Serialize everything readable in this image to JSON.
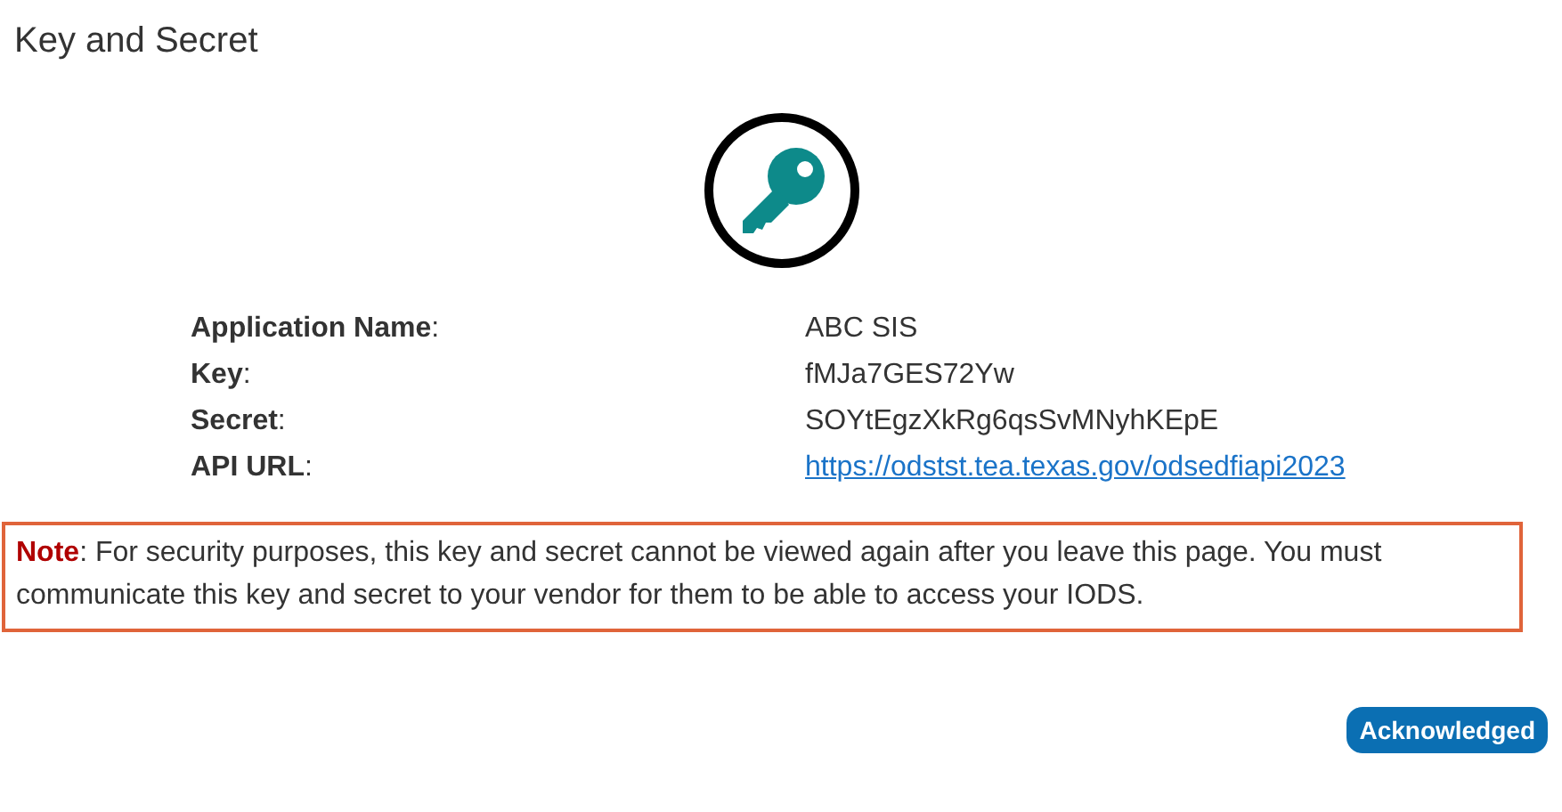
{
  "title": "Key and Secret",
  "details": [
    {
      "label": "**Application Name**:",
      "value": "ABC SIS",
      "kind": "text"
    },
    {
      "label": "**Key**:",
      "value": "fMJa7GES72Yw",
      "kind": "text"
    },
    {
      "label": "**Secret**:",
      "value": "SOYtEgzXkRg6qsSvMNyhKEpE",
      "kind": "text"
    },
    {
      "label": "**API URL**:",
      "value": "https://odstst.tea.texas.gov/odsedfiapi2023",
      "kind": "link"
    }
  ],
  "note": "**Note**: For security purposes, this key and secret cannot be viewed again after you leave this page. You must communicate this key and secret to your vendor for them to be able to access your IODS.",
  "button": "Acknowledged"
}
